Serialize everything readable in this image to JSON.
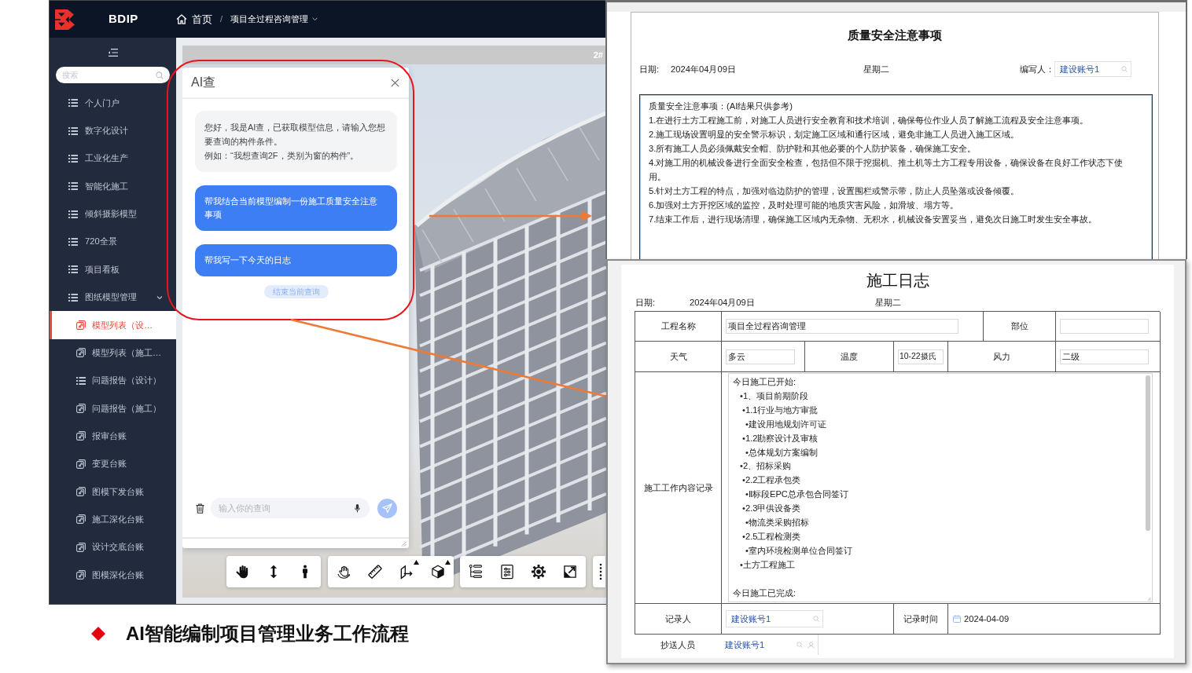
{
  "app": {
    "brand": "BDIP",
    "breadcrumb": {
      "separator": "/",
      "items": [
        {
          "label": "首页",
          "kind": "home"
        },
        {
          "label": "项目全过程咨询管理",
          "kind": "dropdown"
        }
      ]
    },
    "sidebar": {
      "search_placeholder": "搜索",
      "items": [
        {
          "label": "个人门户",
          "kind": "list",
          "selected": false
        },
        {
          "label": "数字化设计",
          "kind": "list",
          "selected": false
        },
        {
          "label": "工业化生产",
          "kind": "list",
          "selected": false
        },
        {
          "label": "智能化施工",
          "kind": "list",
          "selected": false
        },
        {
          "label": "倾斜摄影模型",
          "kind": "list",
          "selected": false
        },
        {
          "label": "720全景",
          "kind": "list",
          "selected": false
        },
        {
          "label": "项目看板",
          "kind": "list",
          "selected": false
        },
        {
          "label": "图纸模型管理",
          "kind": "list",
          "selected": false,
          "expanded": true,
          "children": [
            {
              "label": "模型列表（设…",
              "kind": "link",
              "selected": true
            },
            {
              "label": "模型列表（施工…",
              "kind": "link",
              "selected": false
            },
            {
              "label": "问题报告（设计）",
              "kind": "list",
              "selected": false
            },
            {
              "label": "问题报告（施工）",
              "kind": "link",
              "selected": false
            },
            {
              "label": "报审台账",
              "kind": "link",
              "selected": false
            },
            {
              "label": "变更台账",
              "kind": "link",
              "selected": false
            },
            {
              "label": "图模下发台账",
              "kind": "link",
              "selected": false
            },
            {
              "label": "施工深化台账",
              "kind": "link",
              "selected": false
            },
            {
              "label": "设计交底台账",
              "kind": "link",
              "selected": false
            },
            {
              "label": "图模深化台账",
              "kind": "link",
              "selected": false
            }
          ]
        }
      ]
    },
    "viewer": {
      "title": "2#"
    },
    "chat": {
      "title": "AI查",
      "messages": [
        {
          "kind": "assistant",
          "paragraphs": [
            "您好，我是AI查，已获取模型信息，请输入您想要查询的构件条件。",
            "例如：“我想查询2F，类别为窗的构件”。"
          ]
        },
        {
          "kind": "user",
          "paragraphs": [
            "帮我结合当前模型编制一份施工质量安全注意事项"
          ]
        },
        {
          "kind": "user",
          "paragraphs": [
            "帮我写一下今天的日志"
          ]
        }
      ],
      "end_button": "结束当前查询",
      "input_placeholder": "输入你的查询"
    },
    "toolbar": [
      {
        "tools": [
          {
            "kind": "hand",
            "has_menu": false
          },
          {
            "kind": "vertical",
            "has_menu": false
          },
          {
            "kind": "person",
            "has_menu": false
          }
        ]
      },
      {
        "tools": [
          {
            "kind": "orbit",
            "has_menu": false
          },
          {
            "kind": "ruler",
            "has_menu": false
          },
          {
            "kind": "section",
            "has_menu": true
          },
          {
            "kind": "cube",
            "has_menu": true
          }
        ]
      },
      {
        "tools": [
          {
            "kind": "tree",
            "has_menu": false
          },
          {
            "kind": "properties",
            "has_menu": false
          },
          {
            "kind": "settings",
            "has_menu": false
          },
          {
            "kind": "fullscreen",
            "has_menu": false
          }
        ]
      },
      {
        "tools": [
          {
            "kind": "more",
            "has_menu": false
          }
        ]
      }
    ]
  },
  "safety_notes": {
    "title": "质量安全注意事项",
    "date_label": "日期:",
    "date": "2024年04月09日",
    "weekday": "星期二",
    "author_label": "编写人：",
    "author": "建设账号1",
    "lines": [
      "质量安全注意事项：(AI结果只供参考)",
      "1.在进行土方工程施工前，对施工人员进行安全教育和技术培训，确保每位作业人员了解施工流程及安全注意事项。",
      "2.施工现场设置明显的安全警示标识，划定施工区域和通行区域，避免非施工人员进入施工区域。",
      "3.所有施工人员必须佩戴安全帽、防护鞋和其他必要的个人防护装备，确保施工安全。",
      "4.对施工用的机械设备进行全面安全检查，包括但不限于挖掘机、推土机等土方工程专用设备，确保设备在良好工作状态下使用。",
      "5.针对土方工程的特点，加强对临边防护的管理，设置围栏或警示带，防止人员坠落或设备倾覆。",
      "6.加强对土方开挖区域的监控，及时处理可能的地质灾害风险，如滑坡、塌方等。",
      "7.结束工作后，进行现场清理，确保施工区域内无杂物、无积水，机械设备安置妥当，避免次日施工时发生安全事故。"
    ]
  },
  "construction_log": {
    "title": "施工日志",
    "date_label": "日期:",
    "date": "2024年04月09日",
    "weekday": "星期二",
    "project_name_label": "工程名称",
    "project_name": "项目全过程咨询管理",
    "location_label": "部位",
    "weather_label": "天气",
    "weather": "多云",
    "temperature_label": "温度",
    "temperature": "10-22摄氏",
    "wind_label": "风力",
    "wind": "二级",
    "record_label": "施工工作内容记录",
    "record": {
      "sections": [
        {
          "heading": "今日施工已开始:",
          "items": [
            {
              "text": "•1、项目前期阶段",
              "children": [
                {
                  "text": "•1.1行业与地方审批",
                  "children": [
                    {
                      "text": "•建设用地规划许可证"
                    }
                  ]
                },
                {
                  "text": "•1.2勘察设计及审核",
                  "children": [
                    {
                      "text": "•总体规划方案编制"
                    }
                  ]
                }
              ]
            },
            {
              "text": "•2、招标采购",
              "children": [
                {
                  "text": "•2.2工程承包类",
                  "children": [
                    {
                      "text": "•Ⅱ标段EPC总承包合同签订"
                    }
                  ]
                },
                {
                  "text": "•2.3甲供设备类",
                  "children": [
                    {
                      "text": "•物流类采购招标"
                    }
                  ]
                },
                {
                  "text": "•2.5工程检测类",
                  "children": [
                    {
                      "text": "•室内环境检测单位合同签订"
                    }
                  ]
                }
              ]
            },
            {
              "text": "•土方工程施工"
            }
          ]
        },
        {
          "heading": "今日施工已完成:"
        }
      ]
    },
    "recorder_label": "记录人",
    "recorder": "建设账号1",
    "record_time_label": "记录时间",
    "record_time": "2024-04-09",
    "cc_label": "抄送人员",
    "cc": "建设账号1"
  },
  "caption": "AI智能编制项目管理业务工作流程"
}
